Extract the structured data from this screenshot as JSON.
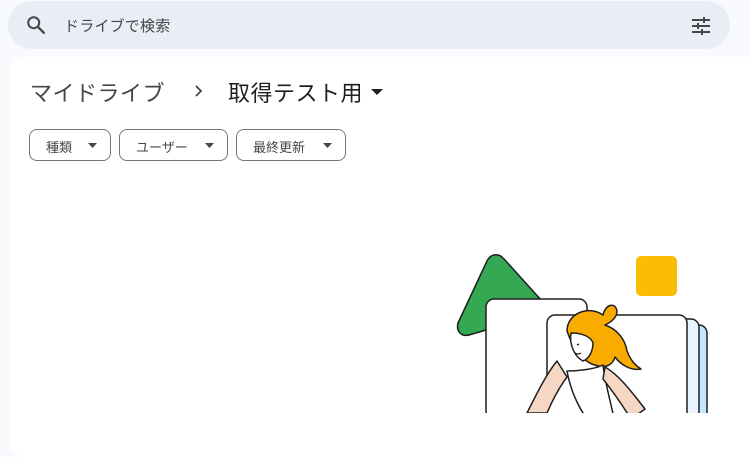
{
  "search": {
    "placeholder": "ドライブで検索",
    "search_icon": "search-icon",
    "filter_icon": "tune-icon"
  },
  "breadcrumb": {
    "root": "マイドライブ",
    "separator_icon": "chevron-right-icon",
    "current": "取得テスト用",
    "caret_icon": "arrow-drop-down-icon"
  },
  "filters": [
    {
      "label": "種類"
    },
    {
      "label": "ユーザー"
    },
    {
      "label": "最終更新"
    }
  ],
  "colors": {
    "page_bg": "#f8fafd",
    "search_bg": "#e9eef6",
    "green": "#34a853",
    "yellow": "#fbbc04",
    "hair": "#f9ab00",
    "blue_light": "#c2e7ff"
  }
}
